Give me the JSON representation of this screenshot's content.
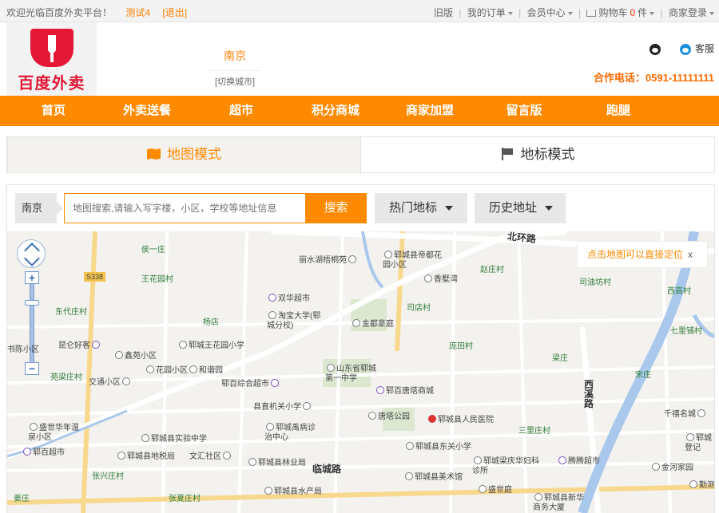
{
  "topbar": {
    "welcome": "欢迎光临百度外卖平台！",
    "user": "测试4",
    "logout": "[退出]",
    "old_version": "旧版",
    "my_orders": "我的订单",
    "member_center": "会员中心",
    "cart_label": "购物车",
    "cart_count": "0",
    "cart_unit": "件",
    "merchant_login": "商家登录"
  },
  "header": {
    "brand": "百度外卖",
    "city_name": "南京",
    "city_switch": "[切换城市]",
    "service_label": "客服",
    "phone": "合作电话：0591-11111111"
  },
  "nav": {
    "items": [
      "首页",
      "外卖送餐",
      "超市",
      "积分商城",
      "商家加盟",
      "留言版",
      "跑腿"
    ]
  },
  "modes": {
    "map_mode": "地图模式",
    "landmark_mode": "地标模式"
  },
  "search": {
    "city": "南京",
    "placeholder": "地图搜索,请输入写字楼，小区，学校等地址信息",
    "button": "搜索",
    "hot_landmarks": "热门地标",
    "history_address": "历史地址"
  },
  "map": {
    "hint": "点击地图可以直接定位",
    "hint_close": "x",
    "zoom_in": "+",
    "zoom_out": "−",
    "labels": {
      "beihuan": "北环路",
      "houyizhuang": "侯一庄",
      "liyuanhu": "丽水湖梧桐苑",
      "dijing": "郓城县帝都花园小区",
      "xiangshuwan": "香墅湾",
      "zhaozhuang": "赵庄村",
      "siyoufang": "司油坊村",
      "xigao": "西高村",
      "route": "S338",
      "wanghuayuan": "王花园村",
      "dongdai": "东代庄村",
      "shuanghua": "双华超市",
      "taobao": "淘宝大学(郓城分校)",
      "jindian": "金都豪庭",
      "siyuan": "司店村",
      "yangdian": "杨店",
      "qixing": "七里铺村",
      "shuchen": "书陈小区",
      "kunlun": "昆仑好客",
      "wanghua_school": "郓城王花园小学",
      "pangtian": "庞田村",
      "xinyuan": "鑫苑小区",
      "huayuan": "花园小区",
      "hexie": "和谐园",
      "shandong_school": "山东省郓城第一中学",
      "liangzhuang": "梁庄",
      "yuanliang": "苑梁庄村",
      "jiaotong": "交通小区",
      "yunbai": "郓百综合超市",
      "yunbai_tower": "郓百唐塔商城",
      "songzhuang": "宋庄",
      "xixi": "西溪路",
      "jiguan": "县直机关小学",
      "tangta": "唐塔公园",
      "renmin": "郓城县人民医院",
      "qianxi": "千禧名城",
      "shengshi": "盛世华年温泉小区",
      "shiyan": "郓城县实验中学",
      "zhongbing": "郓城禹病诊治中心",
      "sanli": "三里庄村",
      "yuncheng_reg": "郓城登记",
      "dongguan": "郓城县东关小学",
      "yunbai2": "郓百超市",
      "dishui": "郓城县地税局",
      "wenhui": "文汇社区",
      "linye": "郓城县林业局",
      "linchenglu": "临城路",
      "liangqing": "郓城梁庆华妇科诊所",
      "tengteng": "腾腾超市",
      "jinhe": "金河家园",
      "zhangxing": "张兴庄村",
      "meishu": "郓城县美术馆",
      "dongce": "勤测",
      "kuangzhuang": "姜庄",
      "zhangxia": "张夏庄村",
      "shuichan": "郓城县水产局",
      "shengshiting": "盛世庭",
      "xinhua": "郓城县新华商务大厦"
    }
  }
}
